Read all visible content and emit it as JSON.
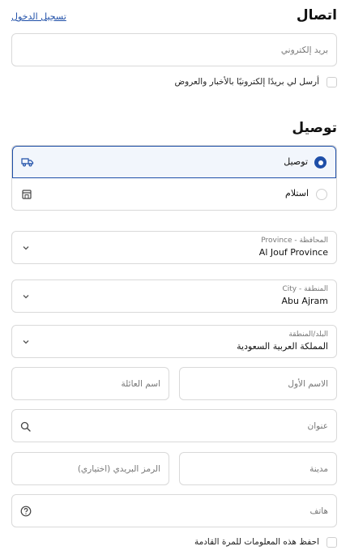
{
  "contact": {
    "title": "اتصال",
    "login_link": "تسجيل الدخول",
    "email_placeholder": "بريد إلكتروني",
    "newsletter_label": "أرسل لي بريدًا إلكترونيًا بالأخبار والعروض"
  },
  "delivery": {
    "title": "توصيل",
    "options": [
      {
        "label": "توصيل",
        "icon": "truck-icon",
        "selected": true
      },
      {
        "label": "استلام",
        "icon": "store-icon",
        "selected": false
      }
    ]
  },
  "address": {
    "province": {
      "label": "Province - المحافظة",
      "value": "Al Jouf Province"
    },
    "city": {
      "label": "City - المنطقة",
      "value": "Abu Ajram"
    },
    "country": {
      "label": "البلد/المنطقة",
      "value": "المملكة العربية السعودية"
    },
    "first_name_placeholder": "الاسم الأول",
    "last_name_placeholder": "اسم العائلة",
    "address_placeholder": "عنوان",
    "city_placeholder": "مدينة",
    "postal_placeholder": "الرمز البريدي (اختياري)",
    "phone_placeholder": "هاتف",
    "save_info_label": "احفظ هذه المعلومات للمرة القادمة"
  },
  "colors": {
    "accent": "#1f4fa8",
    "selected_border": "#1f4fa8",
    "selected_bg": "#f2f6fc",
    "border": "#d9d9d9"
  }
}
